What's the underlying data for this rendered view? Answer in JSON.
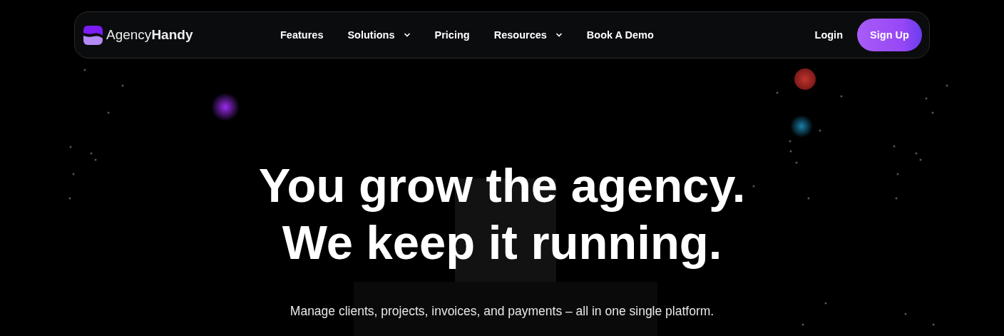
{
  "nav": {
    "logo": "Agency**Handy**",
    "items": [
      {
        "label": "Features",
        "dropdown": false
      },
      {
        "label": "Solutions",
        "dropdown": true
      },
      {
        "label": "Pricing",
        "dropdown": false
      },
      {
        "label": "Resources",
        "dropdown": true
      },
      {
        "label": "Book A Demo",
        "dropdown": false
      }
    ],
    "login": "Login",
    "signup": "Sign Up"
  },
  "hero": {
    "headline": [
      "You grow the agency.",
      "We keep it running."
    ],
    "subtitle": "Manage clients, projects, invoices, and payments – all in one single platform."
  }
}
